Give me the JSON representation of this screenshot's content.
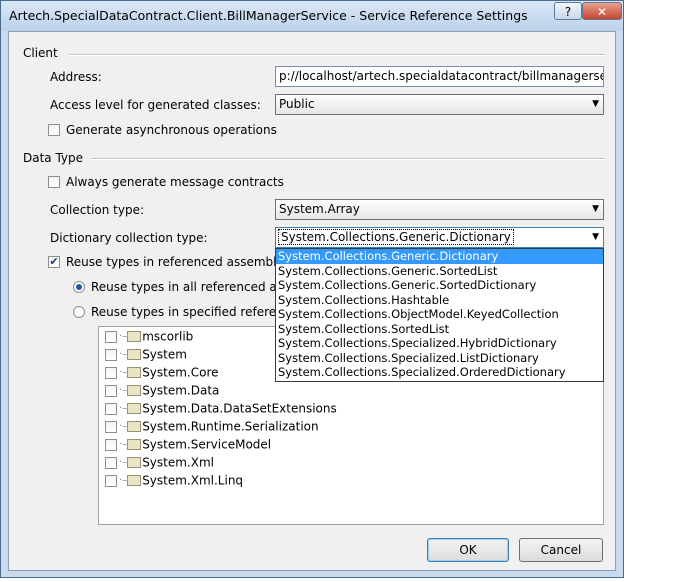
{
  "window": {
    "title": "Artech.SpecialDataContract.Client.BillManagerService - Service Reference Settings",
    "help_glyph": "?",
    "close_glyph": "✕"
  },
  "client_group": {
    "label": "Client",
    "address_label": "Address:",
    "address_value": "p://localhost/artech.specialdatacontract/billmanagerservice.svc",
    "access_label": "Access level for generated classes:",
    "access_value": "Public",
    "async_label": "Generate asynchronous operations",
    "async_checked": false
  },
  "data_group": {
    "label": "Data Type",
    "message_label": "Always generate message contracts",
    "message_checked": false,
    "collection_label": "Collection type:",
    "collection_value": "System.Array",
    "dictionary_label": "Dictionary collection type:",
    "dictionary_value": "System.Collections.Generic.Dictionary",
    "reuse_label": "Reuse types in referenced assemblies",
    "reuse_checked": true,
    "reuse_all_label": "Reuse types in all referenced assemb",
    "reuse_specified_label": "Reuse types in specified referenced a",
    "selected_radio": "all"
  },
  "dropdown_options": [
    "System.Collections.Generic.Dictionary",
    "System.Collections.Generic.SortedList",
    "System.Collections.Generic.SortedDictionary",
    "System.Collections.Hashtable",
    "System.Collections.ObjectModel.KeyedCollection",
    "System.Collections.SortedList",
    "System.Collections.Specialized.HybridDictionary",
    "System.Collections.Specialized.ListDictionary",
    "System.Collections.Specialized.OrderedDictionary"
  ],
  "assemblies": [
    "mscorlib",
    "System",
    "System.Core",
    "System.Data",
    "System.Data.DataSetExtensions",
    "System.Runtime.Serialization",
    "System.ServiceModel",
    "System.Xml",
    "System.Xml.Linq"
  ],
  "buttons": {
    "ok": "OK",
    "cancel": "Cancel"
  },
  "icons": {
    "dropdown_arrow": "chevron-down-icon",
    "assembly": "folder-icon",
    "check": "✔"
  }
}
